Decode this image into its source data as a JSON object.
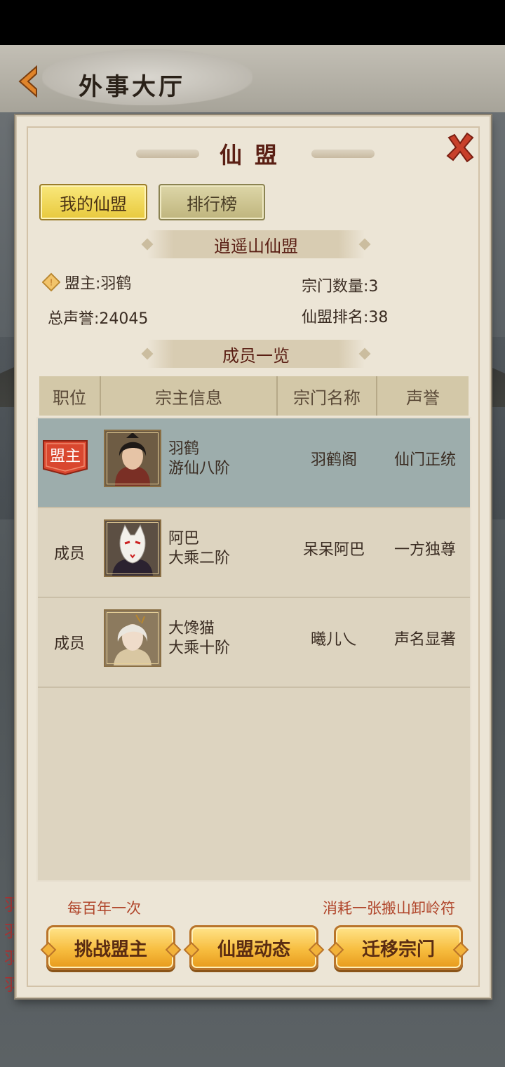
{
  "header": {
    "title": "外事大厅"
  },
  "background": {
    "side_chars": [
      "羽",
      "羽",
      "羽",
      "羽"
    ]
  },
  "panel": {
    "title": "仙盟",
    "tabs": [
      {
        "label": "我的仙盟",
        "active": true
      },
      {
        "label": "排行榜",
        "active": false
      }
    ],
    "alliance_name": "逍遥山仙盟",
    "leader_label": "盟主:羽鹤",
    "total_rep_label": "总声誉:24045",
    "sect_count_label": "宗门数量:3",
    "alliance_rank_label": "仙盟排名:38",
    "members_heading": "成员一览",
    "table": {
      "columns": [
        "职位",
        "宗主信息",
        "宗门名称",
        "声誉"
      ],
      "rows": [
        {
          "position": "盟主",
          "name": "羽鹤",
          "realm": "游仙八阶",
          "sect": "羽鹤阁",
          "reputation": "仙门正统",
          "highlighted": true
        },
        {
          "position": "成员",
          "name": "阿巴",
          "realm": "大乘二阶",
          "sect": "呆呆阿巴",
          "reputation": "一方独尊",
          "highlighted": false
        },
        {
          "position": "成员",
          "name": "大馋猫",
          "realm": "大乘十阶",
          "sect": "曦儿乀",
          "reputation": "声名显著",
          "highlighted": false
        }
      ]
    },
    "notes": {
      "challenge": "每百年一次",
      "migrate": "消耗一张搬山卸岭符"
    },
    "buttons": {
      "challenge": "挑战盟主",
      "news": "仙盟动态",
      "migrate": "迁移宗门"
    }
  },
  "colors": {
    "accent_gold": "#f7bd3f",
    "title_red": "#5a1f14",
    "close_red": "#c8402a",
    "highlight_row": "#9dadac"
  }
}
